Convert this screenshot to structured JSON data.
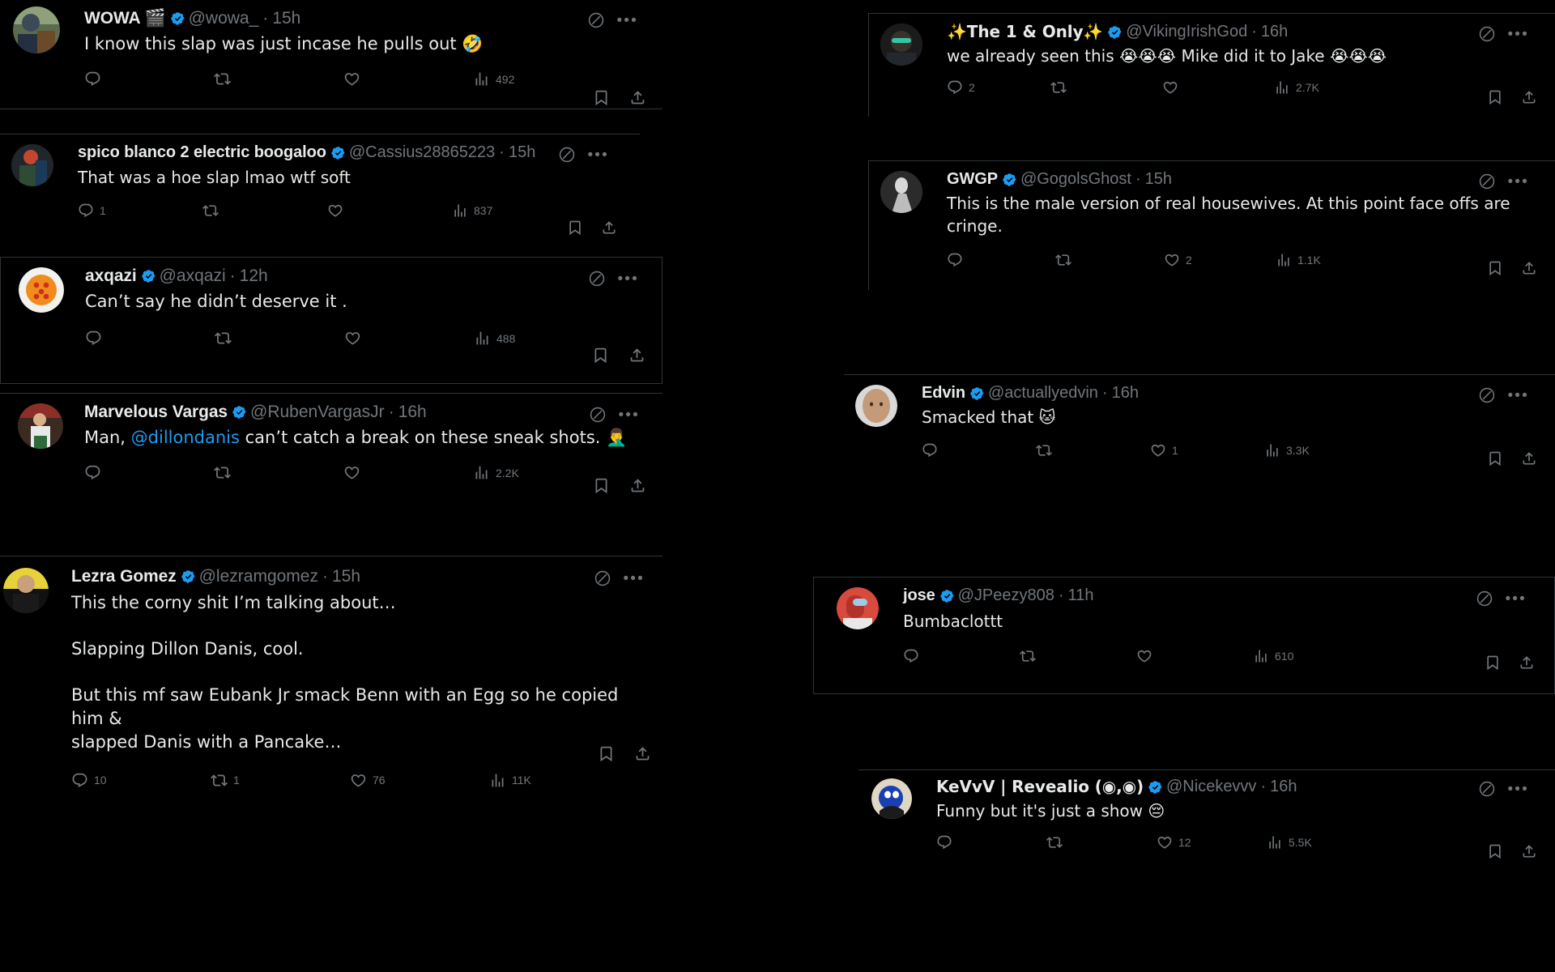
{
  "app": {
    "name": "X (Twitter) replies view",
    "theme": "dark",
    "accent": "#1d9bf0",
    "muted": "#71767b",
    "text": "#e7e9ea",
    "border": "#2f3336"
  },
  "icons": {
    "reply": "reply-icon",
    "retweet": "retweet-icon",
    "like": "like-icon",
    "views": "views-icon",
    "bookmark": "bookmark-icon",
    "share": "share-icon",
    "grok": "grok-icon",
    "more": "more-icon",
    "verified": "verified-badge-icon"
  },
  "labels": {
    "more": "•••"
  },
  "tweets": [
    {
      "id": "wowa",
      "display_name": "WOWA 🎬",
      "handle": "@wowa_",
      "time": "15h",
      "verified": true,
      "text": "I know this slap was just incase he pulls out 🤣",
      "reply_count": "",
      "retweet_count": "",
      "like_count": "",
      "view_count": "492"
    },
    {
      "id": "spico",
      "display_name": "spico blanco 2 electric boogaloo",
      "handle": "@Cassius28865223",
      "time": "15h",
      "verified": true,
      "text": "That was a hoe slap lmao wtf soft",
      "reply_count": "1",
      "retweet_count": "",
      "like_count": "",
      "view_count": "837"
    },
    {
      "id": "axqazi",
      "display_name": "axqazi",
      "handle": "@axqazi",
      "time": "12h",
      "verified": true,
      "text": "Can’t say he didn’t deserve it .",
      "reply_count": "",
      "retweet_count": "",
      "like_count": "",
      "view_count": "488"
    },
    {
      "id": "vargas",
      "display_name": "Marvelous Vargas",
      "handle": "@RubenVargasJr",
      "time": "16h",
      "verified": true,
      "text_pre": "Man, ",
      "mention": "@dillondanis",
      "text_post": " can’t catch a break on these sneak shots. 🤦‍♂️",
      "reply_count": "",
      "retweet_count": "",
      "like_count": "",
      "view_count": "2.2K"
    },
    {
      "id": "lezra",
      "display_name": "Lezra Gomez",
      "handle": "@lezramgomez",
      "time": "15h",
      "verified": true,
      "text": "This the corny shit I’m talking about…\n\nSlapping Dillon Danis, cool.\n\nBut this mf saw Eubank Jr smack Benn with an Egg so he copied him &\nslapped Danis with a Pancake…",
      "reply_count": "10",
      "retweet_count": "1",
      "like_count": "76",
      "view_count": "11K"
    },
    {
      "id": "viking",
      "display_name": "✨The 1 & Only✨",
      "handle": "@VikingIrishGod",
      "time": "16h",
      "verified": true,
      "text": "we already seen this 😭😭😭 Mike did it to Jake 😭😭😭",
      "reply_count": "2",
      "retweet_count": "",
      "like_count": "",
      "view_count": "2.7K"
    },
    {
      "id": "gwgp",
      "display_name": "GWGP",
      "handle": "@GogolsGhost",
      "time": "15h",
      "verified": true,
      "text": "This is the male version of real housewives. At this point face offs are\ncringe.",
      "reply_count": "",
      "retweet_count": "",
      "like_count": "2",
      "view_count": "1.1K"
    },
    {
      "id": "edvin",
      "display_name": "Edvin",
      "handle": "@actuallyedvin",
      "time": "16h",
      "verified": true,
      "text": "Smacked that 🐱",
      "reply_count": "",
      "retweet_count": "",
      "like_count": "1",
      "view_count": "3.3K"
    },
    {
      "id": "jose",
      "display_name": "jose",
      "handle": "@JPeezy808",
      "time": "11h",
      "verified": true,
      "text": "Bumbaclottt",
      "reply_count": "",
      "retweet_count": "",
      "like_count": "",
      "view_count": "610"
    },
    {
      "id": "kevvv",
      "display_name": "KeVvV | Revealio (◉,◉)",
      "handle": "@Nicekevvv",
      "time": "16h",
      "verified": true,
      "text": "Funny but it's just a show 😔",
      "reply_count": "",
      "retweet_count": "",
      "like_count": "12",
      "view_count": "5.5K"
    }
  ]
}
